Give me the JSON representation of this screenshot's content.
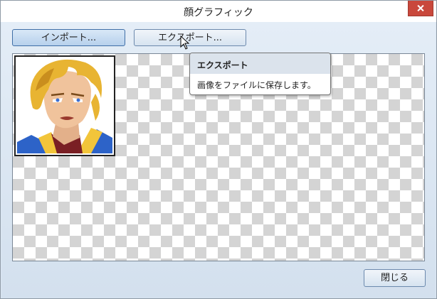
{
  "window": {
    "title": "顔グラフィック",
    "close_icon": "close-icon"
  },
  "toolbar": {
    "import_label": "インポート...",
    "export_label": "エクスポート..."
  },
  "tooltip": {
    "title": "エクスポート",
    "text": "画像をファイルに保存します。"
  },
  "footer": {
    "close_label": "閉じる"
  },
  "canvas": {
    "background": "checkerboard-transparent",
    "face_graphic": "blonde-hero-portrait"
  },
  "colors": {
    "titlebar_close": "#c9483c",
    "button_border": "#6c89ad",
    "dialog_bg": "#dbe7f3"
  }
}
